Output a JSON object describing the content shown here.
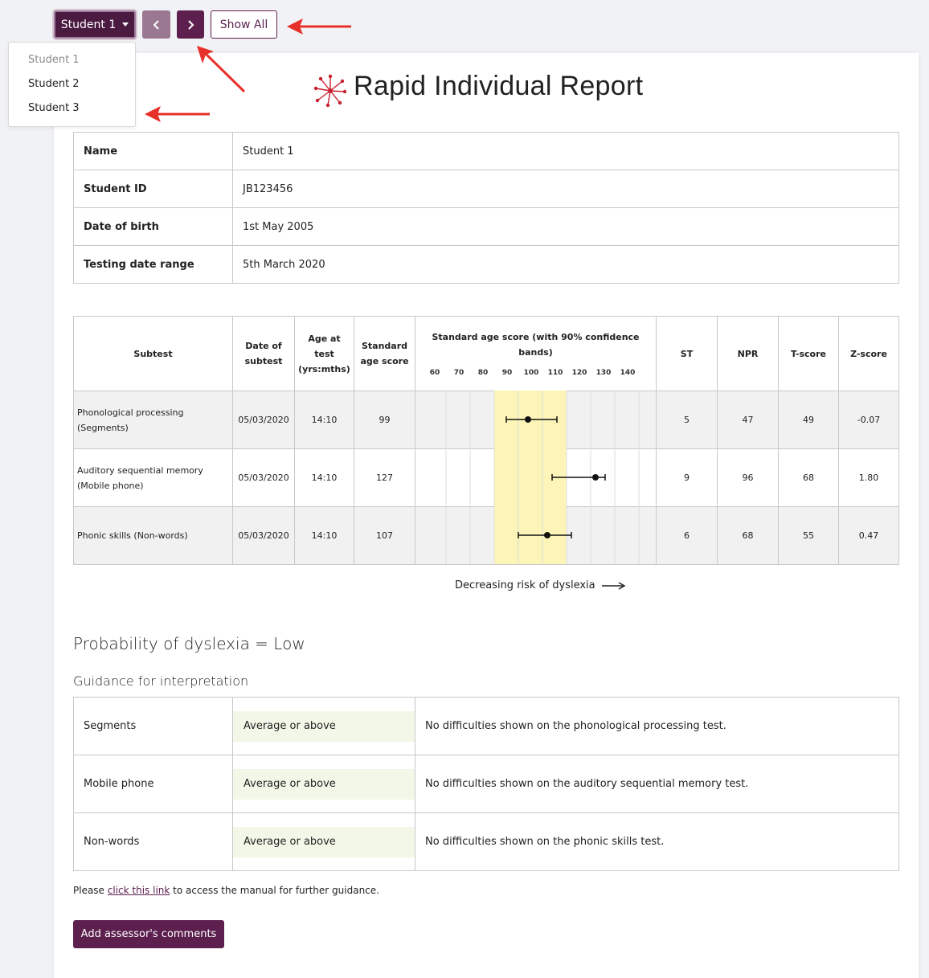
{
  "toolbar": {
    "student_select": "Student 1",
    "show_all": "Show All"
  },
  "dropdown": [
    "Student 1",
    "Student 2",
    "Student 3"
  ],
  "report": {
    "title": "Rapid Individual Report",
    "info": [
      {
        "key": "Name",
        "value": "Student 1"
      },
      {
        "key": "Student ID",
        "value": "JB123456"
      },
      {
        "key": "Date of birth",
        "value": "1st May 2005"
      },
      {
        "key": "Testing date range",
        "value": "5th March 2020"
      }
    ]
  },
  "scores": {
    "headers": {
      "subtest": "Subtest",
      "date": "Date of subtest",
      "age": "Age at test (yrs:mths)",
      "sas": "Standard age score",
      "chart": "Standard age score (with 90% confidence bands)",
      "st": "ST",
      "npr": "NPR",
      "t": "T-score",
      "z": "Z-score"
    },
    "rows": [
      {
        "subtest": "Phonological processing (Segments)",
        "date": "05/03/2020",
        "age": "14:10",
        "sas": "99",
        "st": "5",
        "npr": "47",
        "t": "49",
        "z": "-0.07"
      },
      {
        "subtest": "Auditory sequential memory (Mobile phone)",
        "date": "05/03/2020",
        "age": "14:10",
        "sas": "127",
        "st": "9",
        "npr": "96",
        "t": "68",
        "z": "1.80"
      },
      {
        "subtest": "Phonic skills (Non-words)",
        "date": "05/03/2020",
        "age": "14:10",
        "sas": "107",
        "st": "6",
        "npr": "68",
        "t": "55",
        "z": "0.47"
      }
    ],
    "risk_label": "Decreasing risk of dyslexia"
  },
  "chart_data": {
    "type": "scatter",
    "title": "Standard age score (with 90% confidence bands)",
    "x_ticks": [
      60,
      70,
      80,
      90,
      100,
      110,
      120,
      130,
      140
    ],
    "xlim": [
      55,
      145
    ],
    "average_band": [
      90,
      110
    ],
    "band_color": "#fdf5b8",
    "series": [
      {
        "category": "Phonological processing (Segments)",
        "score": 99,
        "ci": [
          90,
          111
        ]
      },
      {
        "category": "Auditory sequential memory (Mobile phone)",
        "score": 127,
        "ci": [
          109,
          131
        ]
      },
      {
        "category": "Phonic skills (Non-words)",
        "score": 107,
        "ci": [
          95,
          117
        ]
      }
    ]
  },
  "probability": "Probability of dyslexia = Low",
  "guidance": {
    "title": "Guidance for interpretation",
    "rows": [
      {
        "test": "Segments",
        "level": "Average or above",
        "text": "No difficulties shown on the phonological processing test."
      },
      {
        "test": "Mobile phone",
        "level": "Average or above",
        "text": "No difficulties shown on the auditory sequential memory test."
      },
      {
        "test": "Non-words",
        "level": "Average or above",
        "text": "No difficulties shown on the phonic skills test."
      }
    ]
  },
  "note": {
    "before": "Please ",
    "link": "click this link",
    "after": " to access the manual for further guidance."
  },
  "add_comments": "Add assessor's comments"
}
